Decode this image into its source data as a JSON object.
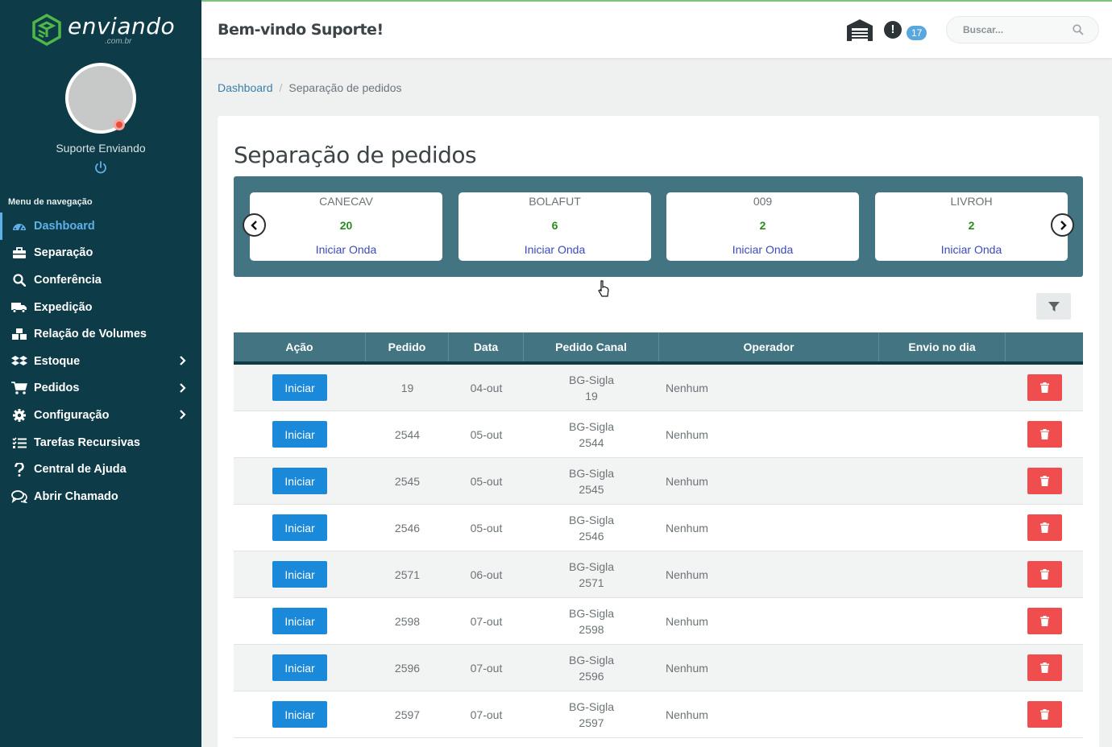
{
  "brand": {
    "name": "enviando",
    "suffix": ".com.br"
  },
  "user": {
    "name": "Suporte Enviando"
  },
  "sidebar": {
    "nav_title": "Menu de navegação",
    "items": [
      {
        "label": "Dashboard",
        "icon": "dashboard-icon",
        "active": true
      },
      {
        "label": "Separação",
        "icon": "toolbox-icon"
      },
      {
        "label": "Conferência",
        "icon": "search-icon"
      },
      {
        "label": "Expedição",
        "icon": "truck-icon"
      },
      {
        "label": "Relação de Volumes",
        "icon": "boxes-icon"
      },
      {
        "label": "Estoque",
        "icon": "dropbox-icon",
        "submenu": true
      },
      {
        "label": "Pedidos",
        "icon": "cart-icon",
        "submenu": true
      },
      {
        "label": "Configuração",
        "icon": "gear-icon",
        "submenu": true
      },
      {
        "label": "Tarefas Recursivas",
        "icon": "tasks-icon"
      },
      {
        "label": "Central de Ajuda",
        "icon": "question-icon"
      },
      {
        "label": "Abrir Chamado",
        "icon": "comments-icon"
      }
    ]
  },
  "header": {
    "welcome": "Bem-vindo Suporte!",
    "alert_symbol": "!",
    "notifications": "17",
    "search_placeholder": "Buscar..."
  },
  "breadcrumb": {
    "home": "Dashboard",
    "current": "Separação de pedidos"
  },
  "page": {
    "title": "Separação de pedidos"
  },
  "waves": [
    {
      "name": "CANECAV",
      "count": "20",
      "action": "Iniciar Onda"
    },
    {
      "name": "BOLAFUT",
      "count": "6",
      "action": "Iniciar Onda"
    },
    {
      "name": "009",
      "count": "2",
      "action": "Iniciar Onda"
    },
    {
      "name": "LIVROH",
      "count": "2",
      "action": "Iniciar Onda"
    }
  ],
  "table": {
    "headers": [
      "Ação",
      "Pedido",
      "Data",
      "Pedido Canal",
      "Operador",
      "Envio no dia",
      ""
    ],
    "rows": [
      {
        "action": "Iniciar",
        "pedido": "19",
        "data": "04-out",
        "canal1": "BG-Sigla",
        "canal2": "19",
        "operador": "Nenhum"
      },
      {
        "action": "Iniciar",
        "pedido": "2544",
        "data": "05-out",
        "canal1": "BG-Sigla",
        "canal2": "2544",
        "operador": "Nenhum"
      },
      {
        "action": "Iniciar",
        "pedido": "2545",
        "data": "05-out",
        "canal1": "BG-Sigla",
        "canal2": "2545",
        "operador": "Nenhum"
      },
      {
        "action": "Iniciar",
        "pedido": "2546",
        "data": "05-out",
        "canal1": "BG-Sigla",
        "canal2": "2546",
        "operador": "Nenhum"
      },
      {
        "action": "Iniciar",
        "pedido": "2571",
        "data": "06-out",
        "canal1": "BG-Sigla",
        "canal2": "2571",
        "operador": "Nenhum"
      },
      {
        "action": "Iniciar",
        "pedido": "2598",
        "data": "07-out",
        "canal1": "BG-Sigla",
        "canal2": "2598",
        "operador": "Nenhum"
      },
      {
        "action": "Iniciar",
        "pedido": "2596",
        "data": "07-out",
        "canal1": "BG-Sigla",
        "canal2": "2596",
        "operador": "Nenhum"
      },
      {
        "action": "Iniciar",
        "pedido": "2597",
        "data": "07-out",
        "canal1": "BG-Sigla",
        "canal2": "2597",
        "operador": "Nenhum"
      }
    ]
  },
  "colors": {
    "sidebar": "#0d3b47",
    "accent": "#437482",
    "primary": "#1a89d9",
    "danger": "#f04e4e",
    "active": "#5fb0e8"
  }
}
